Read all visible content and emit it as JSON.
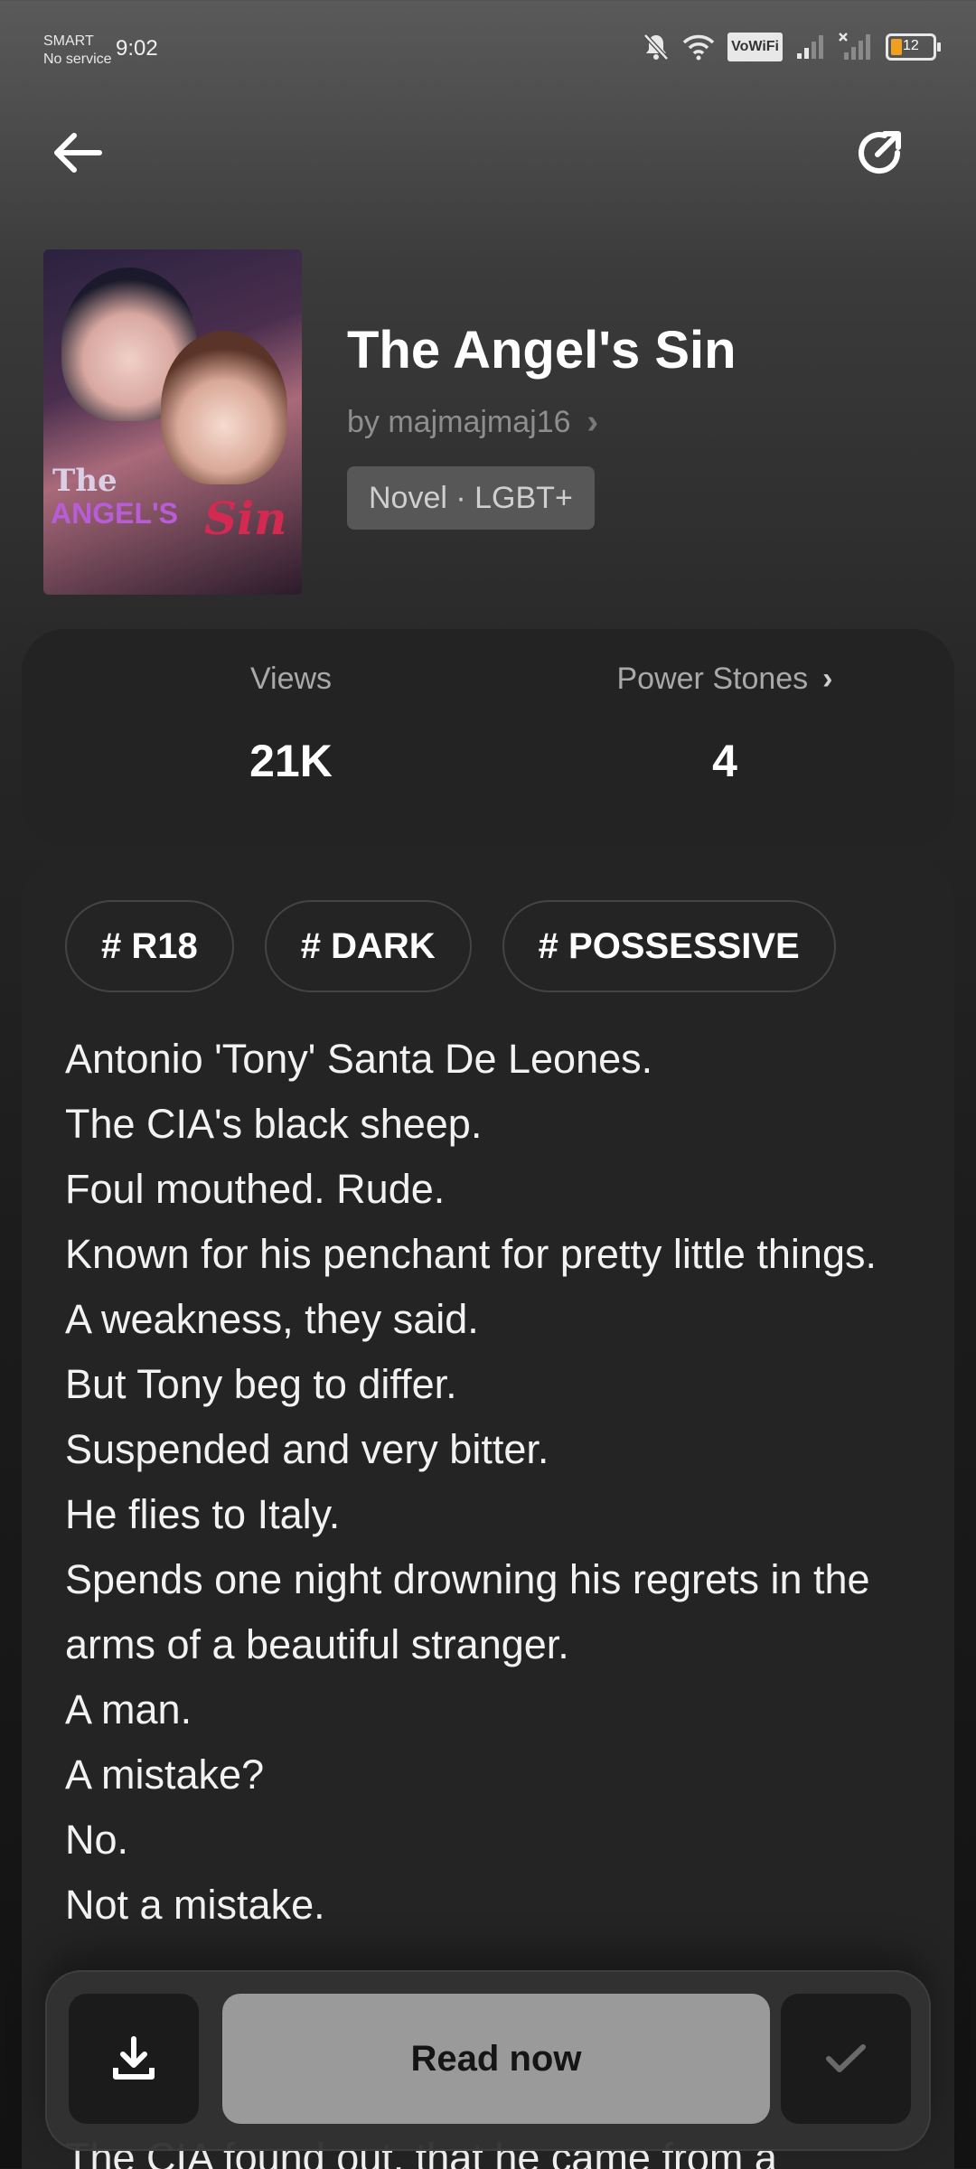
{
  "status_bar": {
    "carrier_line1": "SMART",
    "carrier_line2": "No service",
    "time": "9:02",
    "vowifi": "VoWiFi",
    "battery_level": "12",
    "icons": [
      "mute-bell-icon",
      "wifi-icon",
      "signal-icon",
      "signal-no-service-icon",
      "battery-icon"
    ]
  },
  "header": {
    "back_icon": "arrow-left-icon",
    "share_icon": "share-arrow-icon"
  },
  "book": {
    "cover_title_line1": "The",
    "cover_title_line2": "ANGEL'S",
    "cover_title_sin": "Sin",
    "title": "The Angel's Sin",
    "author": "by majmajmaj16",
    "author_chevron": "›",
    "genre": "Novel · LGBT+"
  },
  "stats": {
    "views_label": "Views",
    "views_value": "21K",
    "power_label": "Power Stones",
    "power_chevron": "›",
    "power_value": "4"
  },
  "tags": [
    "# R18",
    "# DARK",
    "# POSSESSIVE"
  ],
  "synopsis": [
    "Antonio 'Tony' Santa De Leones.",
    "The CIA's black sheep.",
    "Foul mouthed. Rude.",
    "Known for his penchant for pretty little things.",
    "A weakness, they said.",
    "But Tony beg to differ.",
    "Suspended and very bitter.",
    "He flies to Italy.",
    "Spends one night drowning his regrets in the arms of a beautiful stranger.",
    "A man.",
    "A mistake?",
    "No.",
    "Not a mistake."
  ],
  "synopsis_tail": "The CIA found out, that he came from a",
  "actions": {
    "download_icon": "download-icon",
    "read_label": "Read now",
    "check_icon": "check-icon"
  },
  "colors": {
    "accent_read": "#9a9a9a",
    "card_bg": "#242424"
  }
}
